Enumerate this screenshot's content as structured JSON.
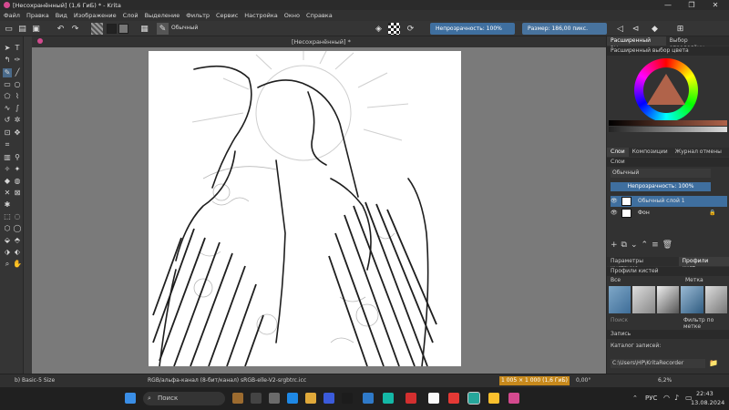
{
  "window": {
    "title": "[Несохранённый]  (1,6 ГиБ)  * - Krita",
    "controls": [
      "—",
      "❐",
      "✕"
    ]
  },
  "menu": [
    "Файл",
    "Правка",
    "Вид",
    "Изображение",
    "Слой",
    "Выделение",
    "Фильтр",
    "Сервис",
    "Настройка",
    "Окно",
    "Справка"
  ],
  "toolbar": {
    "blend_mode": "Обычный",
    "opacity_label": "Непрозрачность: 100%",
    "size_label": "Размер: 186,00 пикс.",
    "foreground_color": "#222222",
    "background_color": "#777777"
  },
  "document_tab": "[Несохранённый]  *",
  "right_panel": {
    "top_tabs": [
      "Расширенный вы...",
      "Выбор определённ..."
    ],
    "color_selector_title": "Расширенный выбор цвета",
    "layer_tabs": [
      "Слои",
      "Композиции",
      "Журнал отмены"
    ],
    "layers_title": "Слои",
    "layer_blend": "Обычный",
    "layer_opacity": "Непрозрачность:  100%",
    "layers": [
      {
        "name": "Обычный слой 1",
        "selected": true
      },
      {
        "name": "Фон",
        "selected": false
      }
    ],
    "tool_tabs": [
      "Параметры инструме...",
      "Профили кист..."
    ],
    "brush_presets_title": "Профили кистей",
    "brush_filter": "Все",
    "brush_tag": "Метка",
    "search_placeholder": "Поиск",
    "filter_by_tag": "Фильтр по метке",
    "recording_title": "Запись",
    "recording_dir_label": "Каталог записей:",
    "recording_dir": "C:\\Users\\HP\\KritaRecorder"
  },
  "status": {
    "brush": "b) Basic-5 Size",
    "color_space": "RGB/альфа-канал (8-бит/канал)  sRGB-elle-V2-srgbtrc.icc",
    "memory": "1 005 × 1 000 (1,6 ГиБ)",
    "rotation": "0,00°",
    "zoom": "6,2%"
  },
  "taskbar": {
    "search": "Поиск",
    "language": "РУС",
    "time": "22:43",
    "date": "13.08.2024"
  }
}
